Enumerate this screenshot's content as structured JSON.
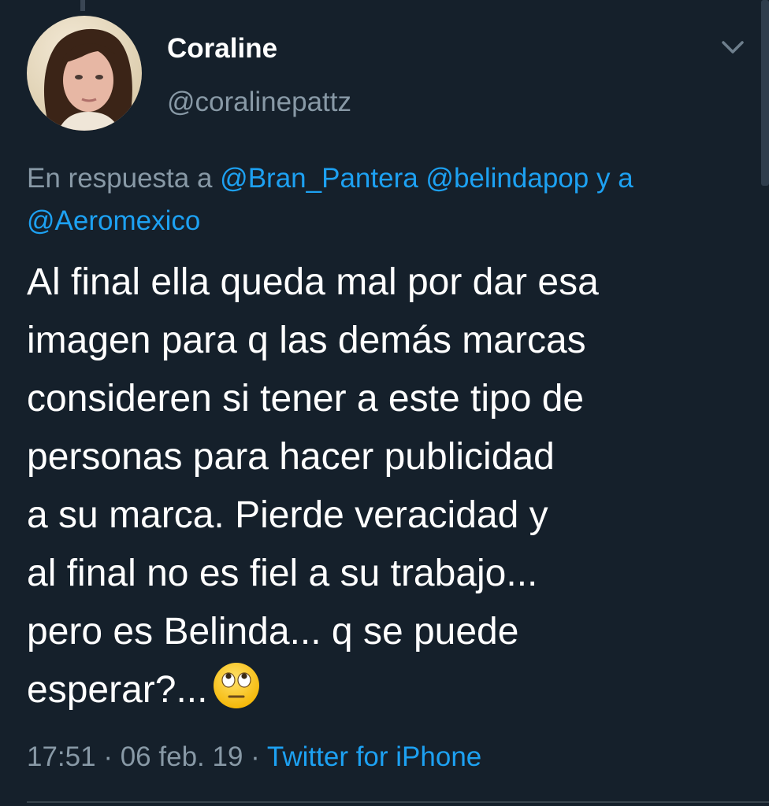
{
  "tweet": {
    "display_name": "Coraline",
    "handle": "@coralinepattz",
    "reply_context": {
      "prefix": "En respuesta a",
      "mentions": [
        "@Bran_Pantera",
        "@belindapop"
      ],
      "conjunction": "y a",
      "last_mention": "@Aeromexico"
    },
    "text": "Al final ella queda mal por dar esa\nimagen para q las demás marcas\nconsideren si tener a este tipo de\npersonas para hacer publicidad\na su marca. Pierde veracidad y\nal final no es fiel a su trabajo...\npero es Belinda... q se puede\nesperar?...",
    "emoji": "rolling-eyes-emoji",
    "time": "17:51",
    "separator": "·",
    "date": "06 feb. 19",
    "source": "Twitter for iPhone"
  },
  "colors": {
    "background": "#15202b",
    "text": "#ffffff",
    "secondary": "#8899a6",
    "link": "#1da1f2"
  },
  "icons": {
    "menu": "chevron-down-icon",
    "avatar": "avatar"
  }
}
